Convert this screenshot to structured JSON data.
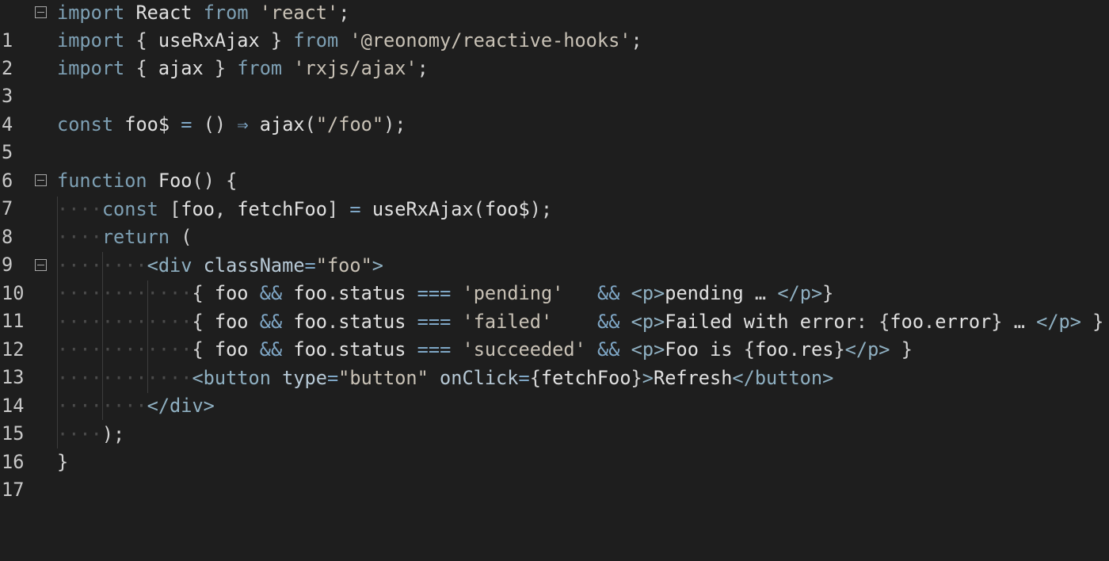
{
  "editor": {
    "lines": [
      {
        "number": "1",
        "code": "import React from 'react';"
      },
      {
        "number": "2",
        "code": "import { useRxAjax } from '@reonomy/reactive-hooks';"
      },
      {
        "number": "3",
        "code": "import { ajax } from 'rxjs/ajax';"
      },
      {
        "number": "4",
        "code": ""
      },
      {
        "number": "5",
        "code": "const foo$ = () ⇒ ajax(\"/foo\");"
      },
      {
        "number": "6",
        "code": ""
      },
      {
        "number": "7",
        "code": "function Foo() {"
      },
      {
        "number": "8",
        "code": "····const [foo, fetchFoo] = useRxAjax(foo$);"
      },
      {
        "number": "9",
        "code": "····return ("
      },
      {
        "number": "10",
        "code": "········<div className=\"foo\">"
      },
      {
        "number": "11",
        "code": "············{ foo && foo.status === 'pending'   && <p>pending … </p>}"
      },
      {
        "number": "12",
        "code": "············{ foo && foo.status === 'failed'    && <p>Failed with error: {foo.error} … </p> }"
      },
      {
        "number": "13",
        "code": "············{ foo && foo.status === 'succeeded' && <p>Foo is {foo.res}</p> }"
      },
      {
        "number": "14",
        "code": "············<button type=\"button\" onClick={fetchFoo}>Refresh</button>"
      },
      {
        "number": "15",
        "code": "········</div>"
      },
      {
        "number": "16",
        "code": "····);"
      },
      {
        "number": "17",
        "code": "}"
      }
    ],
    "fold_lines": [
      "1",
      "7",
      "10"
    ]
  }
}
